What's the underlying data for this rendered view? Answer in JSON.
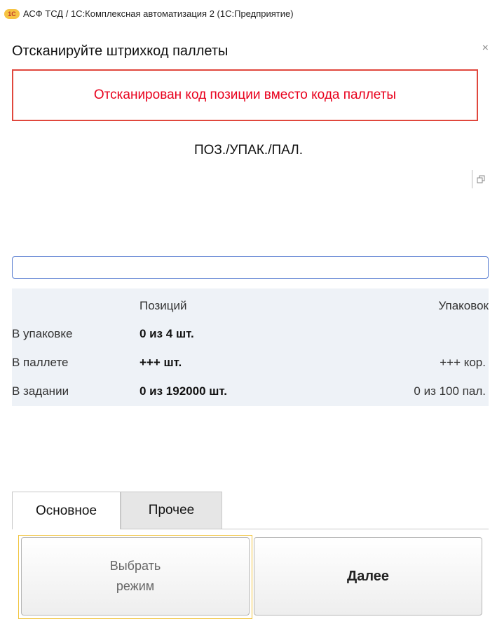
{
  "window": {
    "logo_text": "1С",
    "title": "АСФ ТСД / 1С:Комплексная автоматизация 2  (1С:Предприятие)"
  },
  "form": {
    "heading": "Отсканируйте штрихкод паллеты",
    "close_glyph": "×",
    "error_message": "Отсканирован код позиции вместо кода паллеты",
    "mode_label": "ПОЗ./УПАК./ПАЛ.",
    "barcode_value": ""
  },
  "stats": {
    "col_positions": "Позиций",
    "col_packages": "Упаковок",
    "rows": [
      {
        "label": "В упаковке",
        "positions": "0 из 4 шт.",
        "packages": ""
      },
      {
        "label": "В паллете",
        "positions": "+++ шт.",
        "packages": "+++ кор."
      },
      {
        "label": "В задании",
        "positions": "0 из 192000 шт.",
        "packages": "0 из 100 пал."
      }
    ]
  },
  "tabs": [
    {
      "label": "Основное",
      "active": true
    },
    {
      "label": "Прочее",
      "active": false
    }
  ],
  "buttons": {
    "select_mode_line1": "Выбрать",
    "select_mode_line2": "режим",
    "next": "Далее"
  },
  "icons": {
    "close": "close-icon",
    "expand": "expand-icon",
    "logo": "1c-logo-icon"
  },
  "colors": {
    "error": "#e8001c",
    "error_border": "#e0473d",
    "focus": "#f0c33c",
    "input_border": "#5b7fd1",
    "stats_bg": "#eef2f7"
  }
}
